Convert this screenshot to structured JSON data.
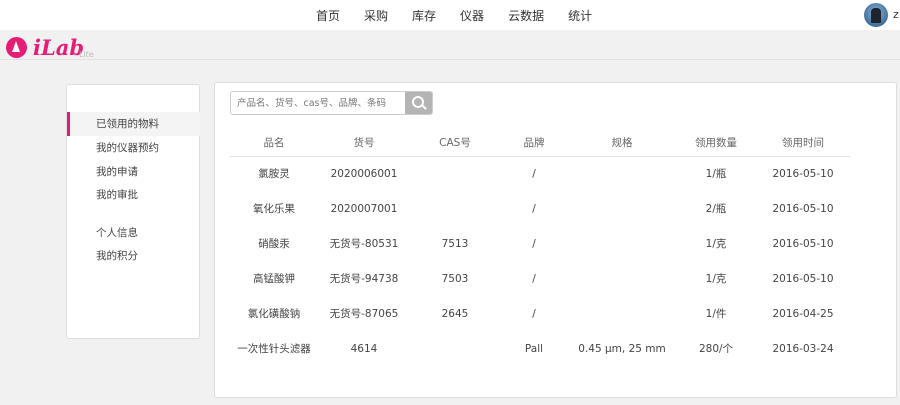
{
  "nav": {
    "items": [
      "首页",
      "采购",
      "库存",
      "仪器",
      "云数据",
      "统计"
    ],
    "username": "z"
  },
  "logo": {
    "text": "iLab",
    "sub": "Lite"
  },
  "sidebar": {
    "items": [
      "已领用的物料",
      "我的仪器预约",
      "我的申请",
      "我的审批",
      "个人信息",
      "我的积分"
    ]
  },
  "search": {
    "placeholder": "产品名、货号、cas号、品牌、条码"
  },
  "table": {
    "headers": [
      "品名",
      "货号",
      "CAS号",
      "品牌",
      "规格",
      "领用数量",
      "领用时间"
    ],
    "rows": [
      [
        "氯胺灵",
        "2020006001",
        "",
        "/",
        "",
        "1/瓶",
        "2016-05-10"
      ],
      [
        "氧化乐果",
        "2020007001",
        "",
        "/",
        "",
        "2/瓶",
        "2016-05-10"
      ],
      [
        "硝酸汞",
        "无货号-80531",
        "7513",
        "/",
        "",
        "1/克",
        "2016-05-10"
      ],
      [
        "高锰酸钾",
        "无货号-94738",
        "7503",
        "/",
        "",
        "1/克",
        "2016-05-10"
      ],
      [
        "氯化磺酸钠",
        "无货号-87065",
        "2645",
        "/",
        "",
        "1/件",
        "2016-04-25"
      ],
      [
        "一次性针头滤器",
        "4614",
        "",
        "Pall",
        "0.45 μm, 25 mm",
        "280/个",
        "2016-03-24"
      ]
    ]
  },
  "colors": {
    "brand": "#e51d75",
    "search_button": "#b4b4b4"
  },
  "icons": {
    "search": "search-icon",
    "logo": "ilab-logo-icon",
    "avatar": "avatar"
  }
}
